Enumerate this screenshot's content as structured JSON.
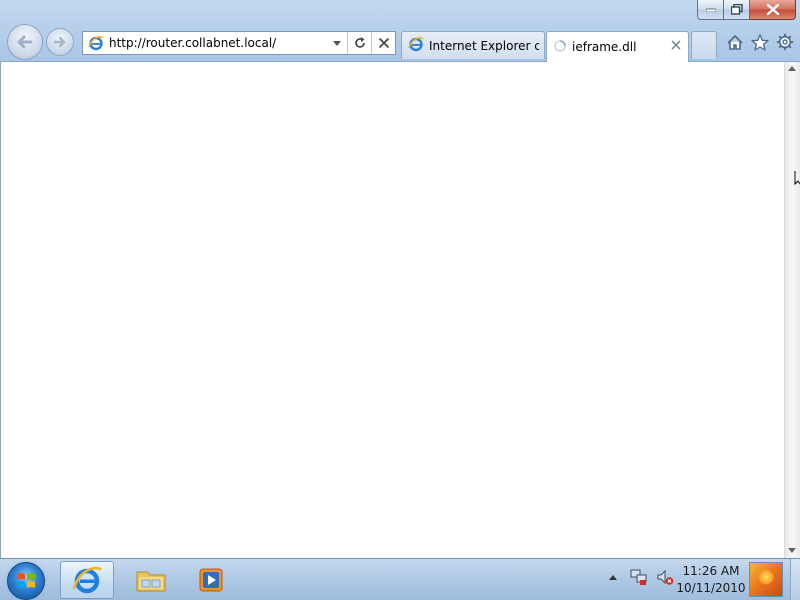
{
  "window": {
    "caption_buttons": [
      "minimize",
      "restore",
      "close"
    ]
  },
  "navigation": {
    "back_icon": "back-arrow-icon",
    "forward_icon": "forward-arrow-icon"
  },
  "address_bar": {
    "url": "http://router.collabnet.local/",
    "site_icon": "ie-page-icon",
    "dropdown_icon": "chevron-down-icon",
    "refresh_icon": "refresh-icon",
    "stop_icon": "stop-icon"
  },
  "tabs": [
    {
      "label": "Internet Explorer ca...",
      "icon": "ie-page-icon",
      "active": false
    },
    {
      "label": "ieframe.dll",
      "icon": "loading-spinner-icon",
      "active": true
    }
  ],
  "toolbar_icons": [
    "home-icon",
    "favorites-star-icon",
    "tools-gear-icon"
  ],
  "taskbar": {
    "pinned": [
      "start-orb",
      "internet-explorer",
      "windows-explorer",
      "windows-media-player"
    ],
    "tray": [
      "show-hidden-icons",
      "network-icon",
      "volume-muted-icon"
    ],
    "clock": {
      "time": "11:26 AM",
      "date": "10/11/2010"
    }
  },
  "colors": {
    "frame": "#b9d1ea",
    "close_button": "#c24a35",
    "taskbar": "#aec7e4"
  }
}
